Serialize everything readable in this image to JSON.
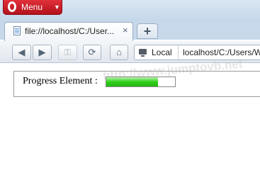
{
  "browser": {
    "menu_label": "Menu",
    "tab_title": "file://localhost/C:/User...",
    "tab_close": "×",
    "new_tab": "+",
    "address_scope_label": "Local",
    "address_url": "localhost/C:/Users/W"
  },
  "toolbar": {
    "back_icon": "arrow-left",
    "forward_icon": "arrow-right",
    "key_icon": "key",
    "reload_icon": "reload",
    "home_icon": "home"
  },
  "page": {
    "label": "Progress Element :",
    "progress_value": 0.75,
    "watermark": "http://www.jumptovb.net"
  },
  "colors": {
    "opera_red": "#cc1f29",
    "progress_green": "#31d11b"
  }
}
